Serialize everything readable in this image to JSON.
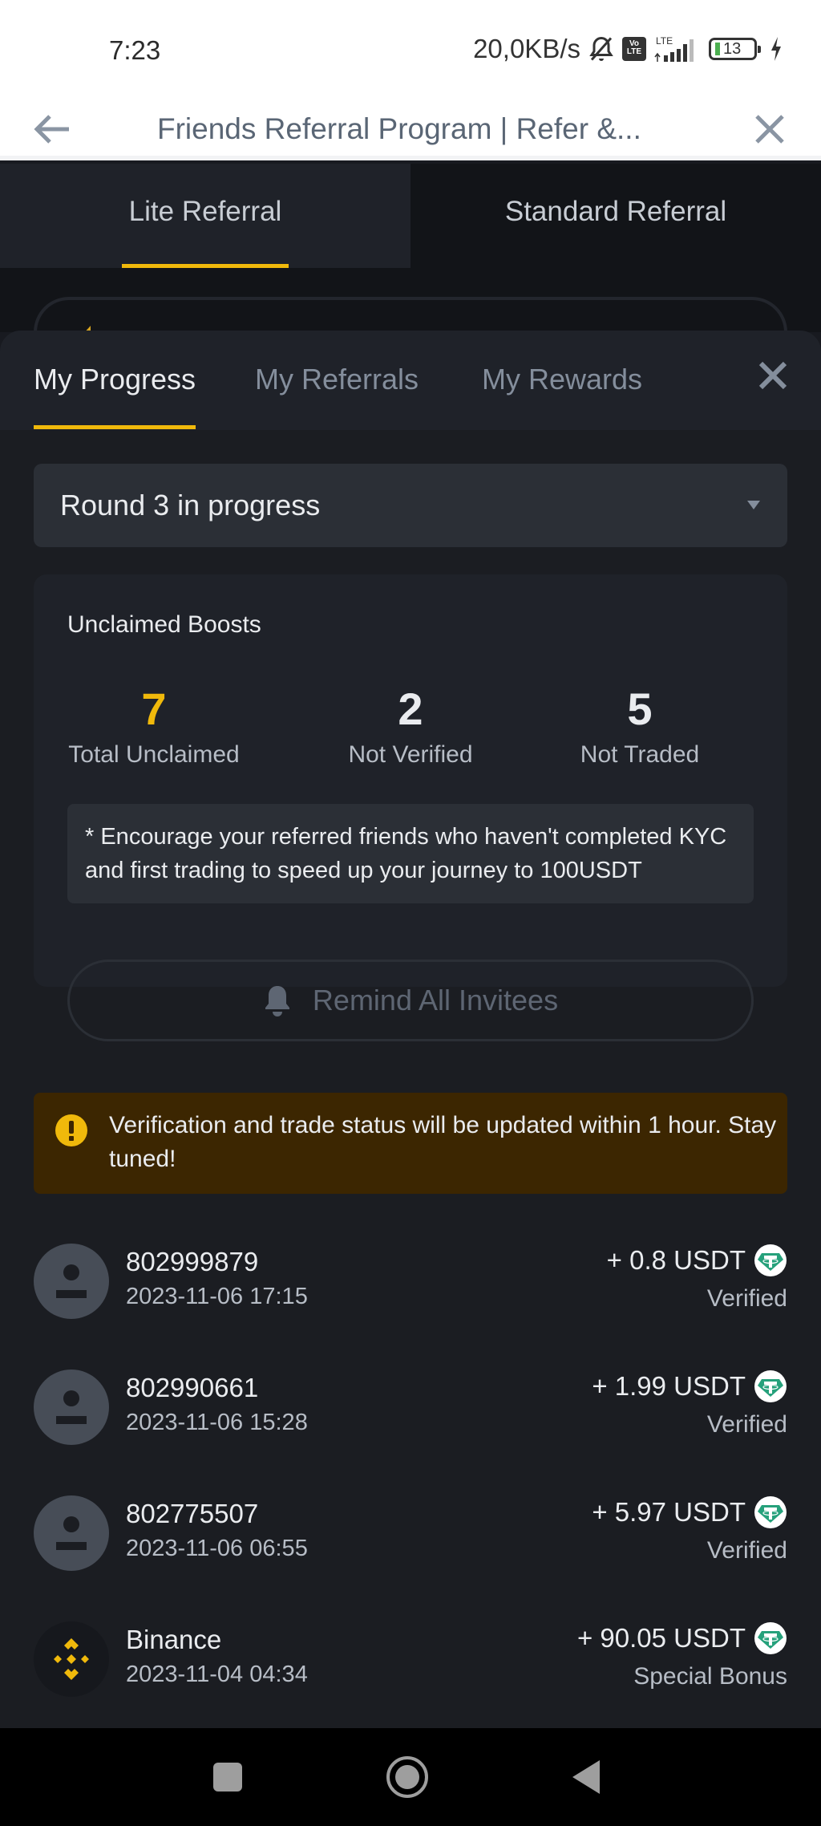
{
  "status_bar": {
    "time": "7:23",
    "net_speed": "20,0KB/s",
    "icons": [
      "bell-muted-icon",
      "volte-icon",
      "lte-signal-icon",
      "battery-icon",
      "charging-icon"
    ],
    "volte_line1": "Vo",
    "volte_line2": "LTE",
    "lte_label": "LTE",
    "battery_level": "13",
    "battery_color": "#4caf50"
  },
  "web_header": {
    "back_icon": "arrow-left-icon",
    "title": "Friends Referral Program | Refer &...",
    "close_icon": "close-icon"
  },
  "referral_tabs": [
    {
      "label": "Lite Referral",
      "active": true
    },
    {
      "label": "Standard Referral",
      "active": false
    }
  ],
  "sheet": {
    "tabs": [
      {
        "label": "My Progress",
        "active": true
      },
      {
        "label": "My Referrals",
        "active": false
      },
      {
        "label": "My Rewards",
        "active": false
      }
    ],
    "close_icon": "close-icon",
    "round_select": {
      "value": "Round 3 in progress",
      "icon": "caret-down-icon"
    },
    "boosts": {
      "title": "Unclaimed Boosts",
      "stats": [
        {
          "value": "7",
          "label": "Total Unclaimed"
        },
        {
          "value": "2",
          "label": "Not Verified"
        },
        {
          "value": "5",
          "label": "Not Traded"
        }
      ],
      "note": "* Encourage your referred friends who haven't completed KYC and first trading to speed up your journey to 100USDT",
      "remind_button": "Remind All Invitees",
      "remind_icon": "bell-icon"
    },
    "warning": {
      "icon": "exclamation-circle-icon",
      "text": "Verification and trade status will be updated within 1 hour. Stay tuned!"
    },
    "referrals": [
      {
        "name": "802999879",
        "date": "2023-11-06 17:15",
        "amount": "+ 0.8 USDT",
        "status": "Verified",
        "avatar": "user-icon"
      },
      {
        "name": "802990661",
        "date": "2023-11-06 15:28",
        "amount": "+ 1.99 USDT",
        "status": "Verified",
        "avatar": "user-icon"
      },
      {
        "name": "802775507",
        "date": "2023-11-06 06:55",
        "amount": "+ 5.97 USDT",
        "status": "Verified",
        "avatar": "user-icon"
      },
      {
        "name": "Binance",
        "date": "2023-11-04 04:34",
        "amount": "+ 90.05 USDT",
        "status": "Special Bonus",
        "avatar": "binance-logo-icon"
      }
    ],
    "token_icon": "usdt-tether-icon"
  },
  "colors": {
    "accent": "#f0b90b",
    "background": "#181a20",
    "card": "#1f2229",
    "warning_bg": "#3c2601",
    "tether_green": "#26a17b"
  },
  "nav_bar": [
    "recents-square-icon",
    "home-circle-icon",
    "back-triangle-icon"
  ]
}
